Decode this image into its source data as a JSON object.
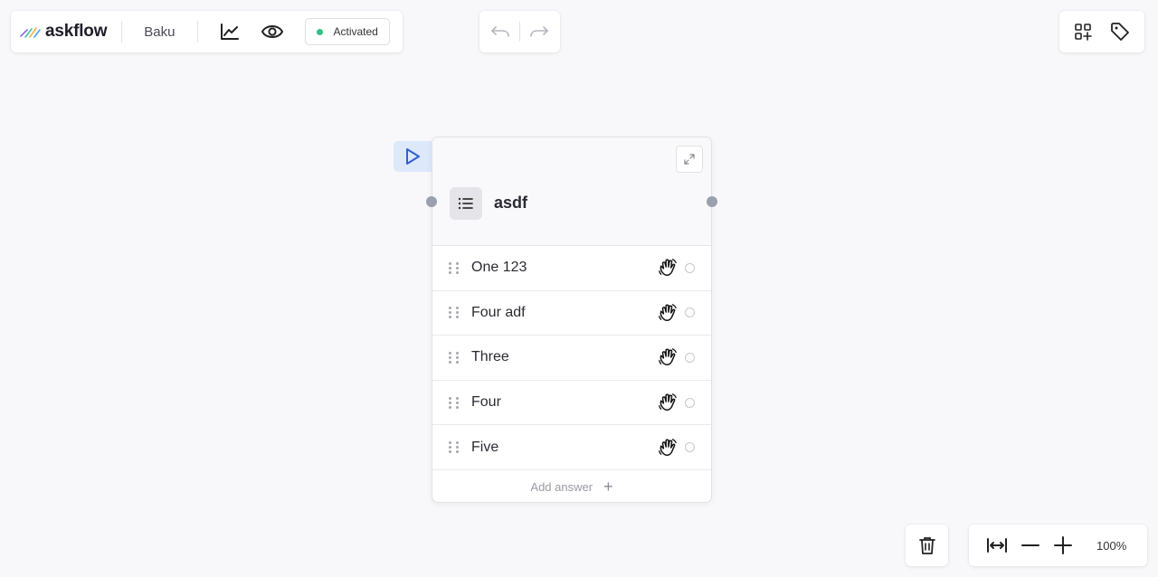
{
  "app": {
    "name": "askflow"
  },
  "toolbar": {
    "project_name": "Baku",
    "analytics_icon": "chart-icon",
    "preview_icon": "eye-icon",
    "status_label": "Activated",
    "status_color": "#2ec27e"
  },
  "history": {
    "undo_icon": "undo-icon",
    "redo_icon": "redo-icon"
  },
  "right_toolbar": {
    "add_block_icon": "add-block-icon",
    "tags_icon": "tag-icon"
  },
  "node": {
    "title": "asdf",
    "icon": "list-icon",
    "answers": [
      {
        "label": "One 123"
      },
      {
        "label": "Four adf"
      },
      {
        "label": "Three"
      },
      {
        "label": "Four"
      },
      {
        "label": "Five"
      }
    ],
    "add_answer_label": "Add answer",
    "add_answer_icon": "+"
  },
  "zoom": {
    "level": "100%"
  },
  "colors": {
    "accent": "#2f5fd6",
    "start_bg": "#dde8fb",
    "canvas": "#f8f8fb"
  }
}
